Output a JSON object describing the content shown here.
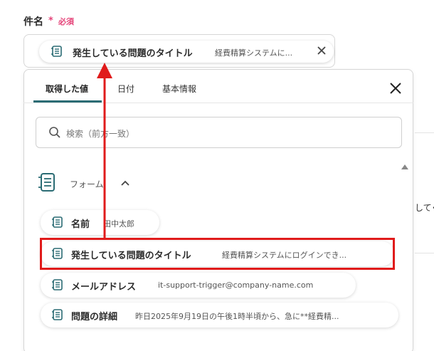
{
  "field": {
    "label": "件名",
    "required_mark": "*",
    "required_text": "必須",
    "chip": {
      "title": "発生している問題のタイトル",
      "value": "経費精算システムに..."
    }
  },
  "tabs": [
    {
      "label": "取得した値",
      "active": true
    },
    {
      "label": "日付",
      "active": false
    },
    {
      "label": "基本情報",
      "active": false
    }
  ],
  "search": {
    "placeholder": "検索（前方一致）"
  },
  "group": {
    "label": "フォーム"
  },
  "items": [
    {
      "title": "名前",
      "value": "田中太郎"
    },
    {
      "title": "発生している問題のタイトル",
      "value": "経費精算システムにログインでき..."
    },
    {
      "title": "メールアドレス",
      "value": "it-support-trigger@company-name.com"
    },
    {
      "title": "問題の詳細",
      "value": "昨日2025年9月19日の午後1時半頃から、急に**経費精..."
    }
  ],
  "background": {
    "partial_text": "してく"
  },
  "colors": {
    "accent": "#2b6c74",
    "required": "#e5457a",
    "annotation": "#e01b1b"
  }
}
